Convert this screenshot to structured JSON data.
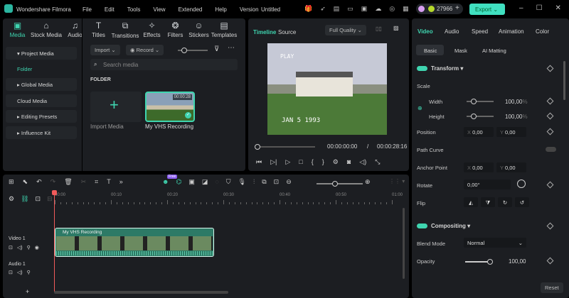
{
  "app": {
    "name": "Wondershare Filmora",
    "title": "Untitled",
    "menu": [
      "File",
      "Edit",
      "Tools",
      "View",
      "Extended",
      "Help",
      "Version"
    ],
    "credits": "27966",
    "export_label": "Export"
  },
  "media_tabs": [
    {
      "label": "Media",
      "icon": "media-icon"
    },
    {
      "label": "Stock Media",
      "icon": "stock-media-icon"
    },
    {
      "label": "Audio",
      "icon": "music-icon"
    },
    {
      "label": "Titles",
      "icon": "titles-icon"
    },
    {
      "label": "Transitions",
      "icon": "transitions-icon"
    },
    {
      "label": "Effects",
      "icon": "effects-icon"
    },
    {
      "label": "Filters",
      "icon": "filters-icon"
    },
    {
      "label": "Stickers",
      "icon": "stickers-icon"
    },
    {
      "label": "Templates",
      "icon": "templates-icon"
    }
  ],
  "sidebar": {
    "items": [
      "Project Media",
      "Folder",
      "Global Media",
      "Cloud Media",
      "Editing Presets",
      "Influence Kit"
    ]
  },
  "media": {
    "import_label": "Import",
    "record_label": "Record",
    "search_placeholder": "Search media",
    "folder_heading": "FOLDER",
    "import_media_label": "Import Media",
    "clip_name": "My VHS Recording",
    "clip_duration": "00:00:28"
  },
  "player": {
    "tab_timeline": "Timeline",
    "tab_source": "Source",
    "quality": "Full Quality",
    "overlay_play": "PLAY",
    "overlay_date": "JAN  5 1993",
    "current_time": "00:00:00:00",
    "separator": "/",
    "total_time": "00:00:28:16"
  },
  "timeline": {
    "ruler": [
      "00:00",
      "00:10",
      "00:20",
      "00:30",
      "00:40",
      "00:50",
      "01:00"
    ],
    "clip_label": "My VHS Recording",
    "track_video": "Video 1",
    "track_audio": "Audio 1",
    "badge": "Free"
  },
  "props": {
    "tabs": [
      "Video",
      "Audio",
      "Speed",
      "Animation",
      "Color"
    ],
    "subtabs": [
      "Basic",
      "Mask",
      "AI Matting"
    ],
    "transform": "Transform",
    "scale": "Scale",
    "width": "Width",
    "height": "Height",
    "width_val": "100,00",
    "height_val": "100,00",
    "pct": "%",
    "position": "Position",
    "x": "X",
    "y": "Y",
    "pos_x": "0,00",
    "pos_y": "0,00",
    "path_curve": "Path Curve",
    "anchor": "Anchor Point",
    "anc_x": "0,00",
    "anc_y": "0,00",
    "rotate": "Rotate",
    "rotate_val": "0,00°",
    "flip": "Flip",
    "compositing": "Compositing",
    "blend_mode": "Blend Mode",
    "blend_val": "Normal",
    "opacity": "Opacity",
    "opacity_val": "100,00",
    "reset": "Reset"
  },
  "colors": {
    "accent": "#3fd5b0",
    "export": "#40e0c0",
    "playhead": "#f05a5a",
    "clip": "#2d7a66"
  }
}
